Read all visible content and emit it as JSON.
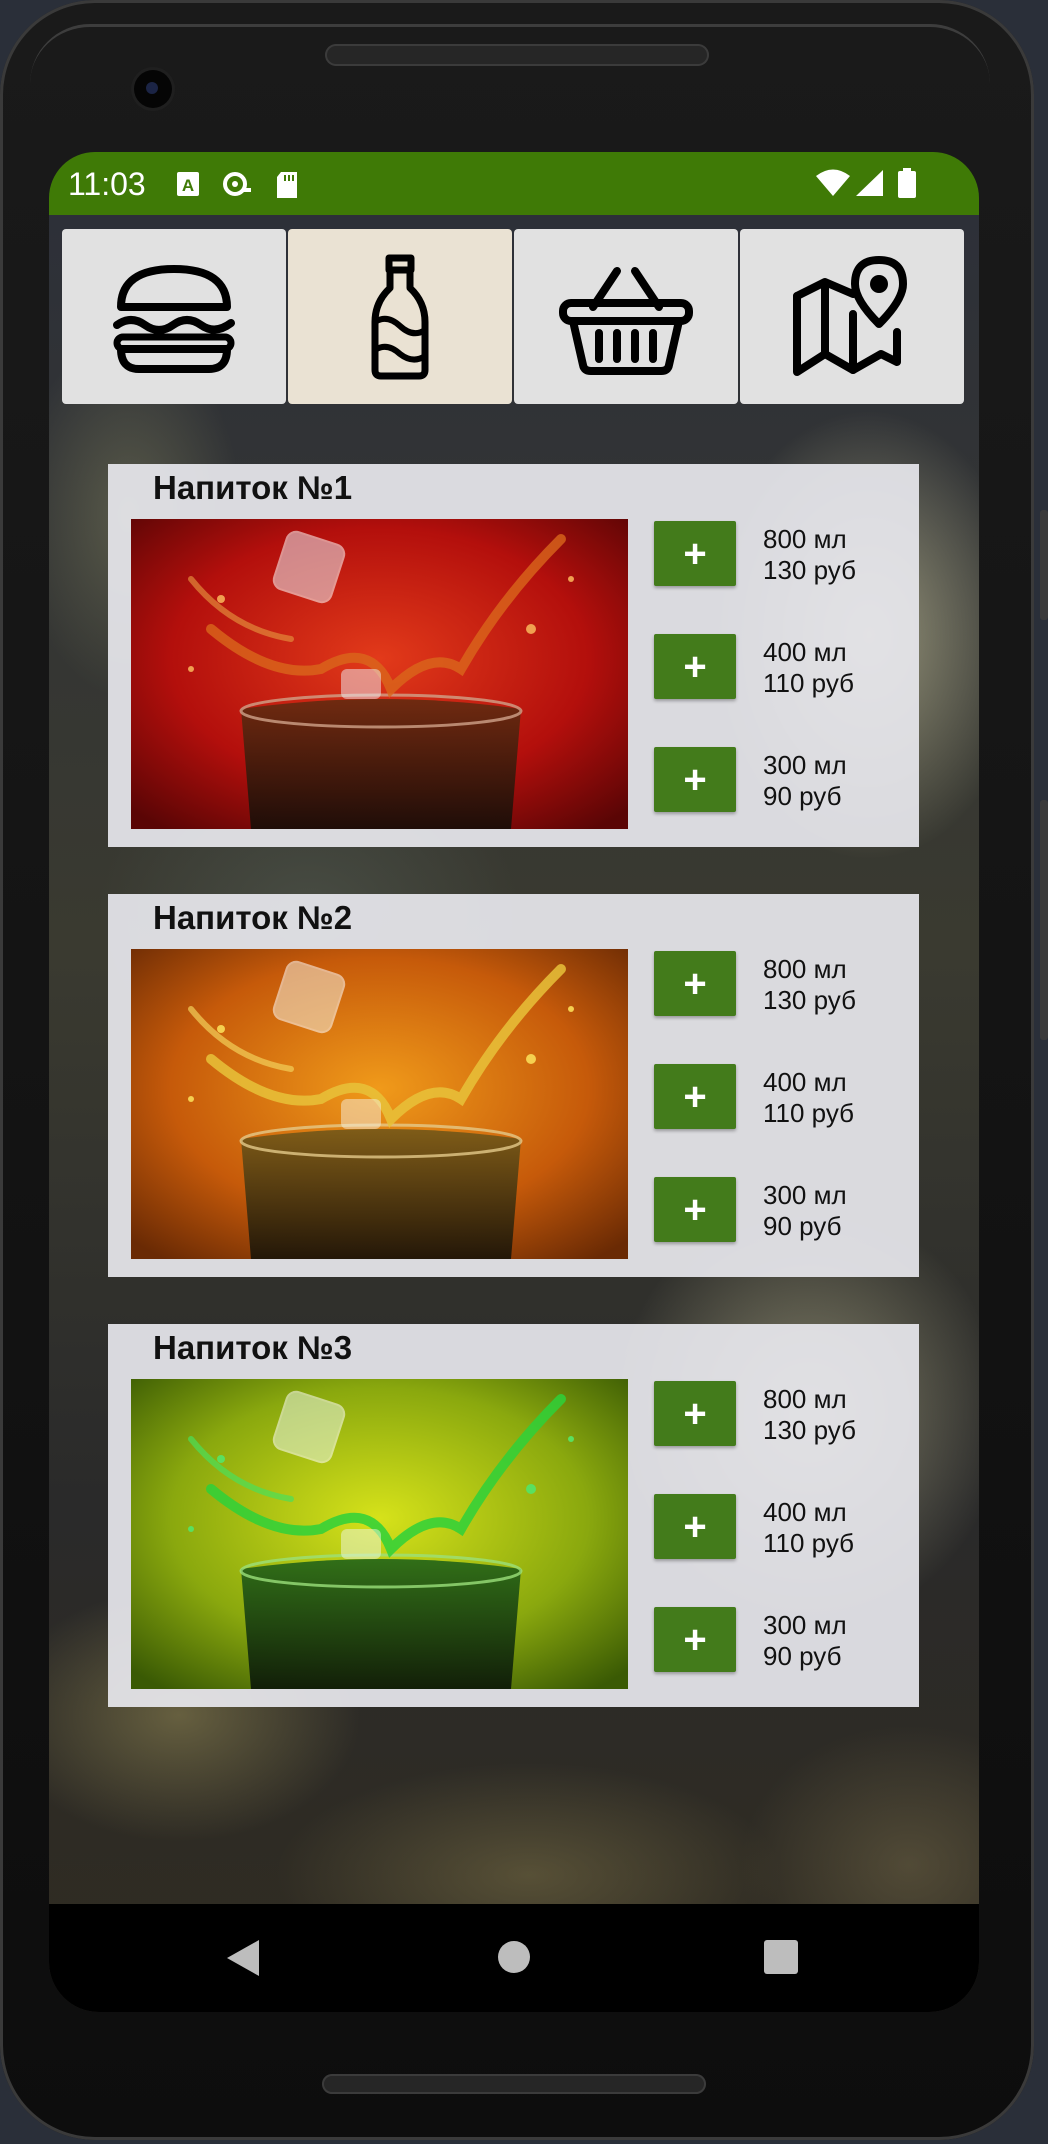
{
  "status_bar": {
    "time": "11:03",
    "left_icons": [
      "text-a-icon",
      "sync-icon",
      "sd-card-icon"
    ],
    "right_icons": [
      "wifi-icon",
      "signal-icon",
      "battery-icon"
    ],
    "color": "#3f7a06"
  },
  "tabs": [
    {
      "icon": "burger-icon",
      "active": false
    },
    {
      "icon": "bottle-icon",
      "active": true
    },
    {
      "icon": "basket-icon",
      "active": false
    },
    {
      "icon": "map-pin-icon",
      "active": false
    }
  ],
  "drinks": [
    {
      "title": "Напиток №1",
      "image_theme": "red",
      "options": [
        {
          "volume": "800 мл",
          "price": "130 руб"
        },
        {
          "volume": "400 мл",
          "price": "110 руб"
        },
        {
          "volume": "300 мл",
          "price": "90 руб"
        }
      ]
    },
    {
      "title": "Напиток №2",
      "image_theme": "orange",
      "options": [
        {
          "volume": "800 мл",
          "price": "130 руб"
        },
        {
          "volume": "400 мл",
          "price": "110 руб"
        },
        {
          "volume": "300 мл",
          "price": "90 руб"
        }
      ]
    },
    {
      "title": "Напиток №3",
      "image_theme": "green",
      "options": [
        {
          "volume": "800 мл",
          "price": "130 руб"
        },
        {
          "volume": "400 мл",
          "price": "110 руб"
        },
        {
          "volume": "300 мл",
          "price": "90 руб"
        }
      ]
    }
  ],
  "add_button_label": "+",
  "accent_color": "#437b1b",
  "nav": [
    "back-icon",
    "home-icon",
    "recents-icon"
  ]
}
